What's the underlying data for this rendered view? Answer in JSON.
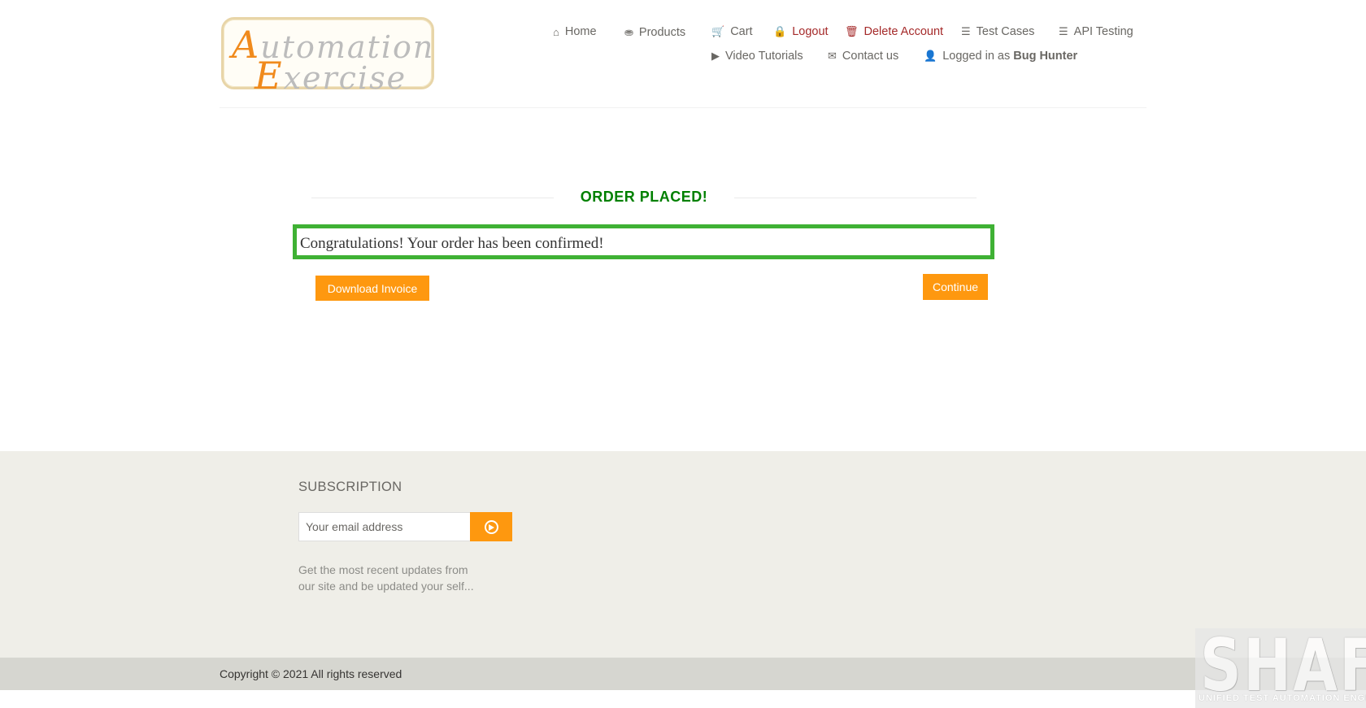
{
  "header": {
    "logo": {
      "line1_cap": "A",
      "line1_rest": "utomation",
      "line2_cap": "E",
      "line2_rest": "xercise"
    },
    "nav": {
      "home": "Home",
      "products": "Products",
      "cart": "Cart",
      "logout": "Logout",
      "delete_account": "Delete Account",
      "test_cases": "Test Cases",
      "api_testing": "API Testing",
      "video_tutorials": "Video Tutorials",
      "contact_us": "Contact us",
      "logged_in_as": "Logged in as",
      "username": "Bug Hunter"
    }
  },
  "main": {
    "title": "ORDER PLACED!",
    "confirmation": "Congratulations! Your order has been confirmed!",
    "download_invoice": "Download Invoice",
    "continue": "Continue"
  },
  "footer": {
    "subscription_title": "SUBSCRIPTION",
    "email_placeholder": "Your email address",
    "description": "Get the most recent updates from our site and be updated your self...",
    "copyright": "Copyright © 2021 All rights reserved"
  },
  "watermark": {
    "big": "SHAFT",
    "small": "UNIFIED TEST AUTOMATION ENGINE"
  },
  "colors": {
    "accent_orange": "#fe980f",
    "success_green": "#008000",
    "box_border": "#3fb134",
    "danger_red": "#a52a2a"
  }
}
